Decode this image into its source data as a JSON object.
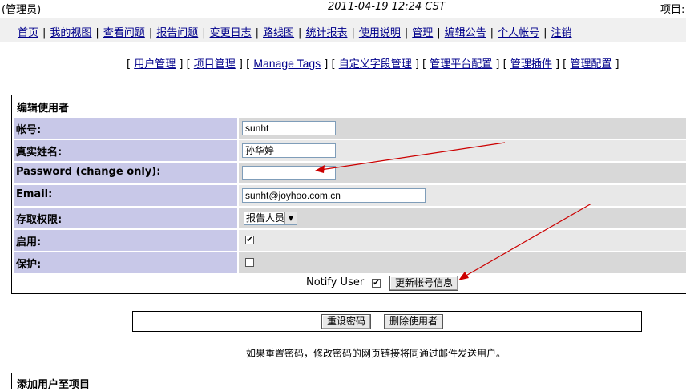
{
  "header": {
    "role": "(管理员)",
    "datetime": "2011-04-19 12:24 CST",
    "project_label": "项目:"
  },
  "menu": {
    "items": [
      "首页",
      "我的视图",
      "查看问题",
      "报告问题",
      "变更日志",
      "路线图",
      "统计报表",
      "使用说明",
      "管理",
      "编辑公告",
      "个人帐号",
      "注销"
    ],
    "separator": "|"
  },
  "submenu": {
    "items": [
      "用户管理",
      "项目管理",
      "Manage Tags",
      "自定义字段管理",
      "管理平台配置",
      "管理插件",
      "管理配置"
    ]
  },
  "form": {
    "title": "编辑使用者",
    "username_label": "帐号:",
    "username_value": "sunht",
    "realname_label": "真实姓名:",
    "realname_value": "孙华婷",
    "password_label": "Password (change only):",
    "password_value": "",
    "email_label": "Email:",
    "email_value": "sunht@joyhoo.com.cn",
    "access_label": "存取权限:",
    "access_value": "报告人员",
    "enabled_label": "启用:",
    "enabled": true,
    "protected_label": "保护:",
    "protected": false,
    "notify_label": "Notify User",
    "notify": true,
    "update_button": "更新帐号信息"
  },
  "actions": {
    "reset_button": "重设密码",
    "delete_button": "删除使用者",
    "note": "如果重置密码，修改密码的网页链接将同通过邮件发送用户。"
  },
  "bottom": {
    "title": "添加用户至项目"
  },
  "icons": {
    "check": "check-icon",
    "dropdown": "chevron-down-icon"
  },
  "colors": {
    "label_bg": "#c8c8e8",
    "row_odd": "#d8d8d8",
    "row_even": "#e8e8e8",
    "link": "#00008b",
    "annotation_arrow": "#cc0000"
  }
}
